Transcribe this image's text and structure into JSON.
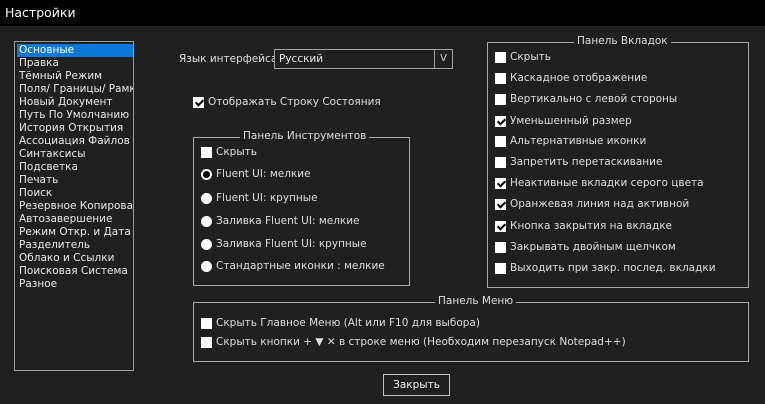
{
  "window": {
    "title": "Настройки"
  },
  "categories": [
    "Основные",
    "Правка",
    "Тёмный Режим",
    "Поля/ Границы/ Рамки",
    "Новый Документ",
    "Путь По Умолчанию",
    "История Открытия",
    "Ассоциация Файлов",
    "Синтаксисы",
    "Подсветка",
    "Печать",
    "Поиск",
    "Резервное Копирование",
    "Автозавершение",
    "Режим Откр. и Дата",
    "Разделитель",
    "Облако и Ссылки",
    "Поисковая Система",
    "Разное"
  ],
  "selected_category": "Основные",
  "language": {
    "label": "Язык интерфейса",
    "value": "Русский",
    "arrow": "V"
  },
  "status_bar": {
    "label": "Отображать Строку Состояния",
    "checked": true
  },
  "toolbar_group": {
    "legend": "Панель Инструментов",
    "hide": {
      "label": "Скрыть",
      "checked": false
    },
    "radios": [
      {
        "label": "Fluent UI: мелкие",
        "checked": true
      },
      {
        "label": "Fluent UI: крупные",
        "checked": false
      },
      {
        "label": "Заливка Fluent UI: мелкие",
        "checked": false
      },
      {
        "label": "Заливка Fluent UI: крупные",
        "checked": false
      },
      {
        "label": "Стандартные иконки : мелкие",
        "checked": false
      }
    ]
  },
  "tabbar_group": {
    "legend": "Панель Вкладок",
    "options": [
      {
        "label": "Скрыть",
        "checked": false
      },
      {
        "label": "Каскадное отображение",
        "checked": false
      },
      {
        "label": "Вертикально с левой стороны",
        "checked": false
      },
      {
        "label": "Уменьшенный размер",
        "checked": true
      },
      {
        "label": "Альтернативные иконки",
        "checked": false
      },
      {
        "label": "Запретить перетаскивание",
        "checked": false
      },
      {
        "label": "Неактивные вкладки серого цвета",
        "checked": true
      },
      {
        "label": "Оранжевая линия над активной",
        "checked": true
      },
      {
        "label": "Кнопка закрытия на вкладке",
        "checked": true
      },
      {
        "label": "Закрывать двойным щелчком",
        "checked": false
      },
      {
        "label": "Выходить при закр. послед. вкладки",
        "checked": false
      }
    ]
  },
  "menu_group": {
    "legend": "Панель Меню",
    "hide_menu": {
      "label": "Скрыть Главное Меню (Alt или F10 для выбора)",
      "checked": false
    },
    "hide_buttons": {
      "label": "Скрыть кнопки  +  ▼ ✕ в строке меню (Необходим перезапуск Notepad++)",
      "checked": false
    }
  },
  "close_button": "Закрыть",
  "colors": {
    "background": "#202020",
    "titlebar": "#000000",
    "selection": "#0a78d7",
    "border": "#a8a8a8"
  }
}
